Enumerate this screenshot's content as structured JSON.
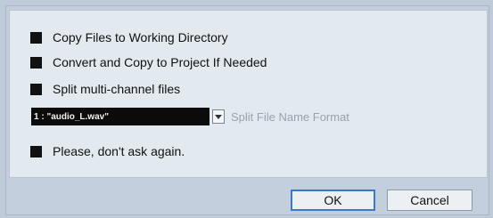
{
  "options": [
    {
      "label": "Copy Files to Working Directory"
    },
    {
      "label": "Convert and Copy to Project If Needed"
    },
    {
      "label": "Split multi-channel files"
    }
  ],
  "split": {
    "selected_value": "1 : \"audio_L.wav\"",
    "format_label": "Split File Name Format"
  },
  "dont_ask_label": "Please, don't ask again.",
  "buttons": {
    "ok": "OK",
    "cancel": "Cancel"
  }
}
